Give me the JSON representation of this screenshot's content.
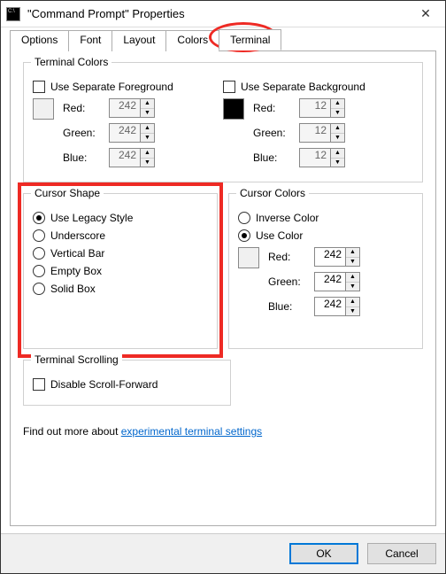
{
  "window": {
    "title": "\"Command Prompt\" Properties"
  },
  "tabs": {
    "options": "Options",
    "font": "Font",
    "layout": "Layout",
    "colors": "Colors",
    "terminal": "Terminal"
  },
  "terminal_colors": {
    "legend": "Terminal Colors",
    "fg_checkbox": "Use Separate Foreground",
    "bg_checkbox": "Use Separate Background",
    "fg": {
      "red_label": "Red:",
      "red_value": "242",
      "green_label": "Green:",
      "green_value": "242",
      "blue_label": "Blue:",
      "blue_value": "242"
    },
    "bg": {
      "red_label": "Red:",
      "red_value": "12",
      "green_label": "Green:",
      "green_value": "12",
      "blue_label": "Blue:",
      "blue_value": "12"
    }
  },
  "cursor_shape": {
    "legend": "Cursor Shape",
    "opt_legacy": "Use Legacy Style",
    "opt_underscore": "Underscore",
    "opt_vertical": "Vertical Bar",
    "opt_empty": "Empty Box",
    "opt_solid": "Solid Box"
  },
  "cursor_colors": {
    "legend": "Cursor Colors",
    "opt_inverse": "Inverse Color",
    "opt_usecolor": "Use Color",
    "red_label": "Red:",
    "red_value": "242",
    "green_label": "Green:",
    "green_value": "242",
    "blue_label": "Blue:",
    "blue_value": "242"
  },
  "terminal_scrolling": {
    "legend": "Terminal Scrolling",
    "disable_label": "Disable Scroll-Forward"
  },
  "link": {
    "prefix": "Find out more about ",
    "text": "experimental terminal settings"
  },
  "buttons": {
    "ok": "OK",
    "cancel": "Cancel"
  }
}
